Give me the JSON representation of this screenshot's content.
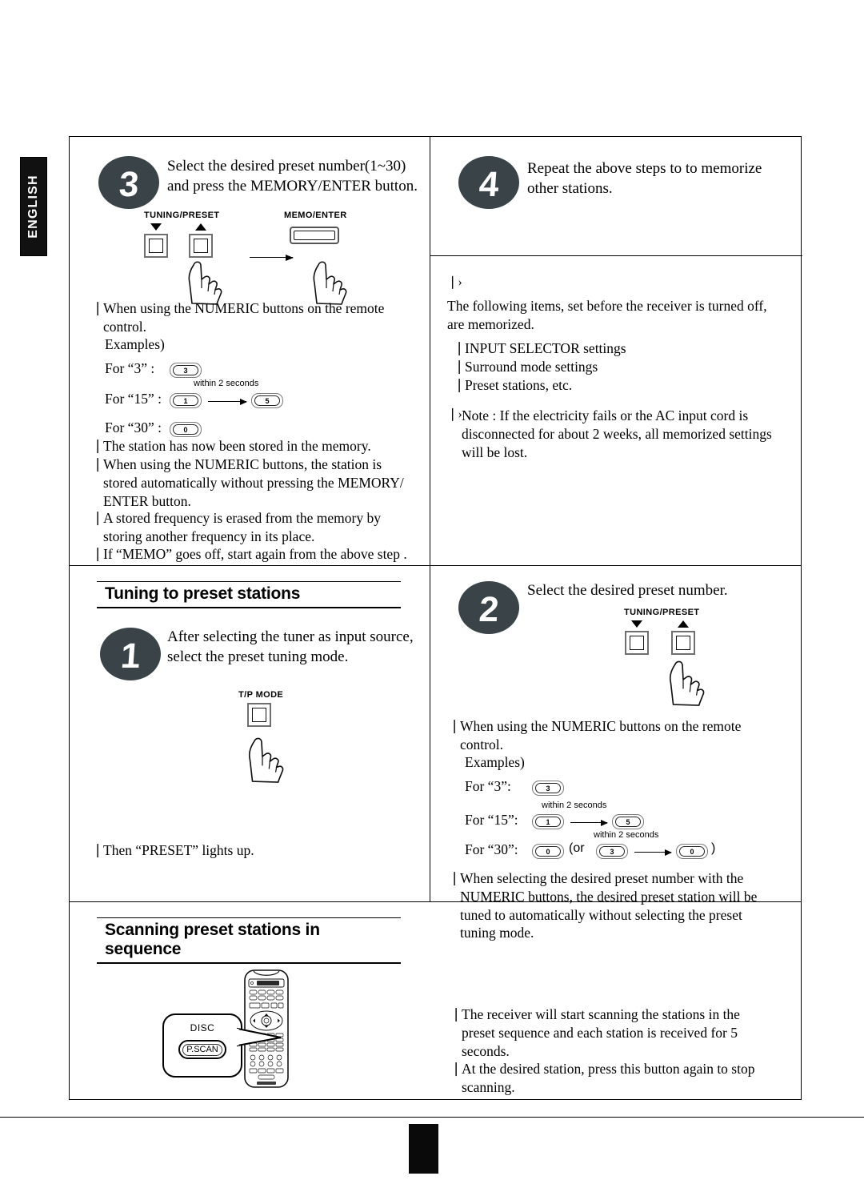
{
  "document": {
    "language_tab": "ENGLISH",
    "page_number": ""
  },
  "sections": {
    "memorizing": {
      "step3": {
        "number": "3",
        "instruction": "Select the desired preset number(1~30) and press the MEMORY/ENTER button.",
        "controls": {
          "tuning_preset_label": "TUNING/PRESET",
          "memo_enter_label": "MEMO/ENTER"
        },
        "bullets": [
          "When using the NUMERIC buttons on the remote control.",
          "The station has now been stored in the memory.",
          "When using the NUMERIC buttons, the station is stored automatically without pressing the MEMORY/ ENTER button.",
          "A stored frequency is erased from the memory by storing another frequency in its place.",
          "If “MEMO” goes off, start again from the above step   ."
        ],
        "examples_label": "Examples)",
        "examples": [
          {
            "label": "For “3” :",
            "keys": [
              "3"
            ],
            "note": ""
          },
          {
            "label": "For “15” :",
            "keys": [
              "1",
              "5"
            ],
            "note": "within 2 seconds"
          },
          {
            "label": "For “30” :",
            "keys": [
              "0"
            ],
            "note": ""
          }
        ]
      },
      "step4": {
        "number": "4",
        "instruction": "Repeat the above steps      to     to memorize other stations."
      },
      "memo_note": {
        "marker": "❘›",
        "intro": "The following items, set before the receiver is turned off, are memorized.",
        "items": [
          "INPUT SELECTOR settings",
          "Surround mode settings",
          "Preset stations, etc."
        ],
        "note": "Note : If the electricity fails or the AC input cord is disconnected for about 2 weeks, all memorized settings will be lost."
      }
    },
    "tuning_to_preset": {
      "heading": "Tuning to preset stations",
      "step1": {
        "number": "1",
        "instruction": "After selecting the tuner as input source, select the preset tuning mode.",
        "control_label": "T/P MODE",
        "bullet": "Then “PRESET” lights up."
      },
      "step2": {
        "number": "2",
        "instruction": "Select the desired preset number.",
        "control_label": "TUNING/PRESET",
        "bullets": [
          "When using the NUMERIC buttons on the remote control.",
          "When selecting the desired preset number with the NUMERIC buttons, the desired preset station will be tuned to automatically without selecting the preset tuning mode."
        ],
        "examples_label": "Examples)",
        "examples": [
          {
            "label": "For “3”:",
            "keys": [
              "3"
            ],
            "note": ""
          },
          {
            "label": "For “15”:",
            "keys": [
              "1",
              "5"
            ],
            "note": "within 2 seconds"
          },
          {
            "label": "For “30”:",
            "keys": [
              "0"
            ],
            "alt_keys": [
              "3",
              "0"
            ],
            "alt_prefix": "(or",
            "alt_suffix": ")",
            "note": "within 2 seconds"
          }
        ]
      }
    },
    "scanning": {
      "heading": "Scanning preset stations in sequence",
      "callout": {
        "title": "DISC",
        "button": "P.SCAN"
      },
      "bullets": [
        "The receiver will start scanning the stations in the preset sequence and each station is received for 5 seconds.",
        "At the desired  station, press this button again to stop scanning."
      ]
    }
  },
  "icons": {
    "bullet_marker": "❘",
    "note_marker": "❘›"
  },
  "colors": {
    "step_bubble": "#3a4448",
    "tab_background": "#111111",
    "rule": "#000000"
  }
}
